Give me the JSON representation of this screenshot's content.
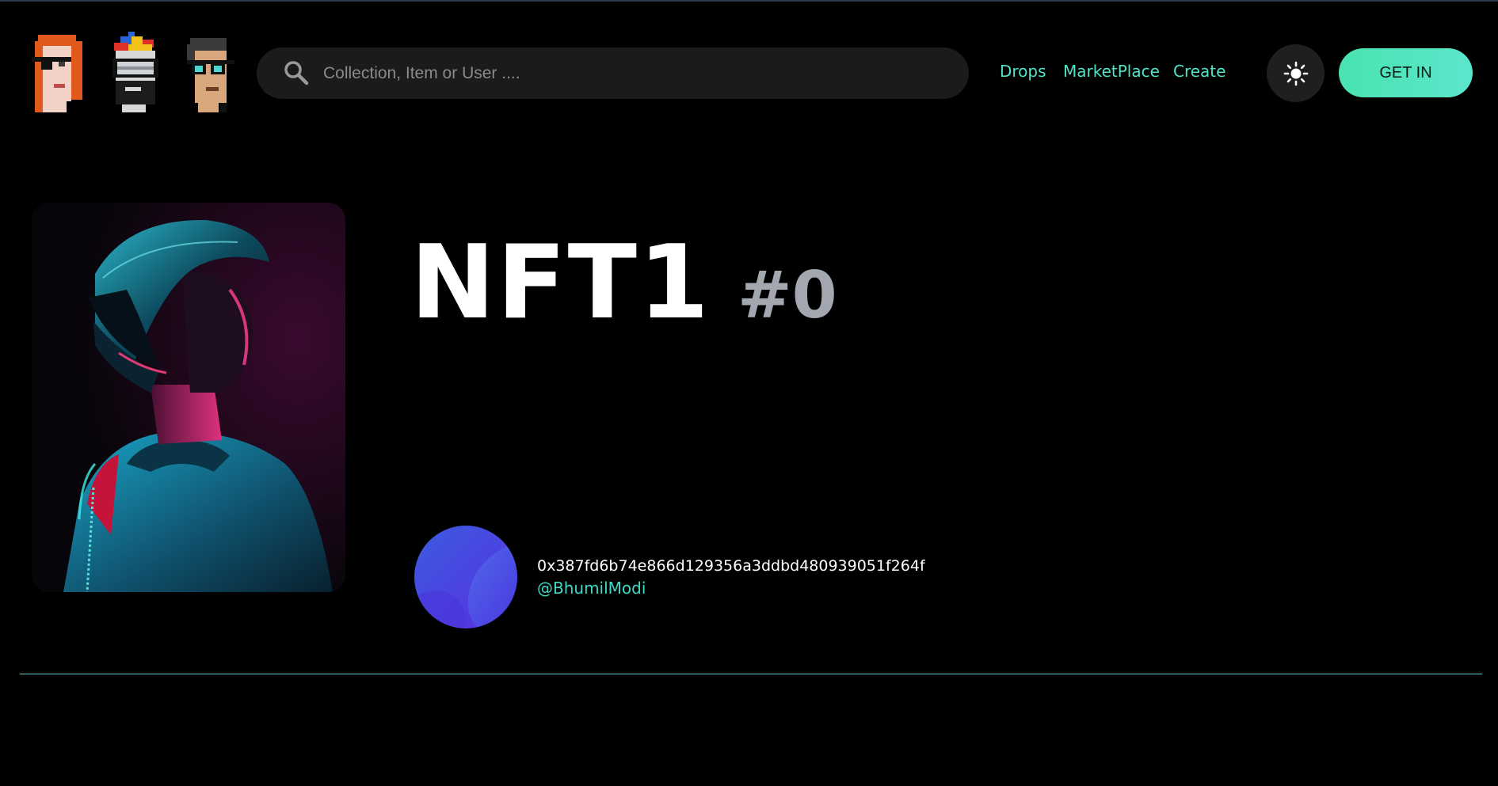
{
  "header": {
    "logo_icon": "pixel-punk-trio-logo",
    "search": {
      "icon": "search-icon",
      "placeholder": "Collection, Item or User ....",
      "value": ""
    },
    "nav": [
      {
        "label": "Drops"
      },
      {
        "label": "MarketPlace"
      },
      {
        "label": "Create"
      }
    ],
    "theme_toggle_icon": "sun-icon",
    "get_in_label": "GET IN"
  },
  "nft": {
    "name": "NFT1",
    "id": "#0",
    "image": "cyber-helmet-figure-artwork"
  },
  "owner": {
    "avatar": "gradient-blob-avatar",
    "address": "0x387fd6b74e866d129356a3ddbd480939051f264f",
    "handle": "@BhumilModi"
  },
  "colors": {
    "background": "#000000",
    "accent": "#4fe3c8",
    "search_bg": "#1b1b1c",
    "id_gray": "#a2a7b0",
    "divider": "#5fd6c3"
  }
}
